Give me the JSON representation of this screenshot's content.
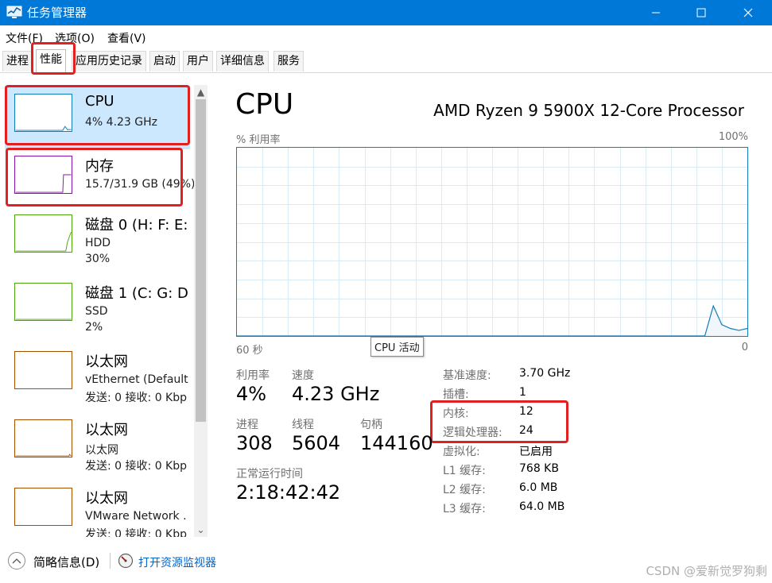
{
  "window": {
    "title": "任务管理器"
  },
  "menu": [
    "文件(F)",
    "选项(O)",
    "查看(V)"
  ],
  "tabs": [
    "进程",
    "性能",
    "应用历史记录",
    "启动",
    "用户",
    "详细信息",
    "服务"
  ],
  "active_tab": "性能",
  "sidebar": {
    "items": [
      {
        "name": "CPU",
        "line1": "4% 4.23 GHz",
        "line2": "",
        "color": "#117dbb",
        "selected": true
      },
      {
        "name": "内存",
        "line1": "15.7/31.9 GB (49%)",
        "line2": "",
        "color": "#8b12ae",
        "selected": false
      },
      {
        "name": "磁盘 0 (H: F: E:",
        "line1": "HDD",
        "line2": "30%",
        "color": "#4da60c",
        "selected": false
      },
      {
        "name": "磁盘 1 (C: G: D",
        "line1": "SSD",
        "line2": "2%",
        "color": "#4da60c",
        "selected": false
      },
      {
        "name": "以太网",
        "line1": "vEthernet (Default",
        "line2": "发送: 0 接收: 0 Kbp",
        "color": "#a74f01",
        "selected": false
      },
      {
        "name": "以太网",
        "line1": "以太网",
        "line2": "发送: 0 接收: 0 Kbp",
        "color": "#a74f01",
        "selected": false
      },
      {
        "name": "以太网",
        "line1": "VMware Network .",
        "line2": "发送: 0 接收: 0 Kbp",
        "color": "#a74f01",
        "selected": false
      }
    ]
  },
  "main": {
    "title": "CPU",
    "model": "AMD Ryzen 9 5900X 12-Core Processor",
    "graph_label_top_left": "% 利用率",
    "graph_label_top_right": "100%",
    "graph_label_bottom_left": "60 秒",
    "graph_label_bottom_right": "0",
    "tooltip": "CPU 活动",
    "stats": {
      "util_label": "利用率",
      "util_value": "4%",
      "speed_label": "速度",
      "speed_value": "4.23 GHz",
      "proc_label": "进程",
      "proc_value": "308",
      "threads_label": "线程",
      "threads_value": "5604",
      "handles_label": "句柄",
      "handles_value": "144160",
      "uptime_label": "正常运行时间",
      "uptime_value": "2:18:42:42"
    },
    "details": [
      {
        "label": "基准速度:",
        "value": "3.70 GHz"
      },
      {
        "label": "插槽:",
        "value": "1"
      },
      {
        "label": "内核:",
        "value": "12"
      },
      {
        "label": "逻辑处理器:",
        "value": "24"
      },
      {
        "label": "虚拟化:",
        "value": "已启用"
      },
      {
        "label": "L1 缓存:",
        "value": "768 KB"
      },
      {
        "label": "L2 缓存:",
        "value": "6.0 MB"
      },
      {
        "label": "L3 缓存:",
        "value": "64.0 MB"
      }
    ],
    "cpu_history_percent": [
      0,
      0,
      0,
      0,
      0,
      0,
      0,
      0,
      0,
      0,
      0,
      0,
      0,
      0,
      0,
      0,
      0,
      0,
      0,
      0,
      0,
      0,
      0,
      0,
      0,
      0,
      0,
      0,
      0,
      0,
      0,
      0,
      0,
      0,
      0,
      0,
      0,
      0,
      0,
      0,
      0,
      0,
      0,
      0,
      0,
      0,
      0,
      0,
      0,
      0,
      0,
      0,
      0,
      0,
      0,
      0,
      16,
      6,
      4,
      3,
      4
    ]
  },
  "footer": {
    "fewer_details": "简略信息(D)",
    "open_resmon": "打开资源监视器",
    "watermark": "CSDN @爱新觉罗狗剩"
  },
  "colors": {
    "titlebar": "#0078d7",
    "cpu": "#117dbb",
    "highlight": "#e32020",
    "link": "#0066cc"
  }
}
